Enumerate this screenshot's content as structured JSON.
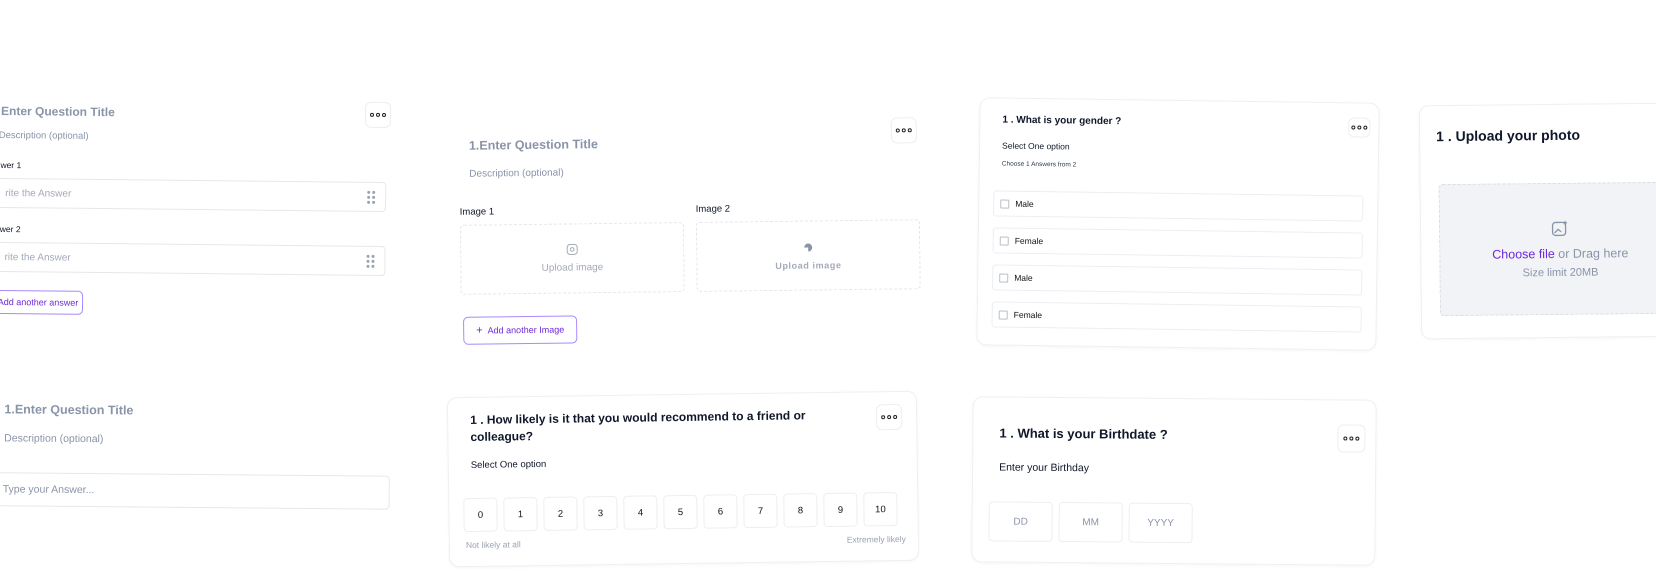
{
  "card_text_question": {
    "title": "Enter Question Title",
    "description": "Description (optional)",
    "answer1_label": "wer 1",
    "answer1_placeholder": "rite the Answer",
    "answer2_label": "wer 2",
    "answer2_placeholder": "rite the Answer",
    "add_button": "Add another answer"
  },
  "card_image_question": {
    "title": "1.Enter Question Title",
    "description": "Description (optional)",
    "image1_label": "Image 1",
    "image1_upload": "Upload image",
    "image2_label": "Image 2",
    "image2_upload": "Upload image",
    "add_button": "Add another Image"
  },
  "card_gender": {
    "title": "1 . What is your gender ?",
    "subtitle": "Select One option",
    "hint": "Choose 1 Answers from 2",
    "options": [
      "Male",
      "Female",
      "Male",
      "Female"
    ]
  },
  "card_upload_photo": {
    "title": "1 . Upload your photo",
    "choose_link": "Choose file",
    "drag_text": " or Drag here",
    "limit": "Size limit 20MB"
  },
  "card_short_answer": {
    "title": "1.Enter Question Title",
    "description": "Description (optional)",
    "placeholder": "Type your Answer..."
  },
  "card_nps": {
    "title": "1 . How likely is it that you would recommend to a friend or colleague?",
    "subtitle": "Select One option",
    "scale": [
      "0",
      "1",
      "2",
      "3",
      "4",
      "5",
      "6",
      "7",
      "8",
      "9",
      "10"
    ],
    "low_label": "Not likely at all",
    "high_label": "Extremely likely"
  },
  "card_birthdate": {
    "title": "1 . What is your Birthdate ?",
    "subtitle": "Enter your Birthday",
    "day": "DD",
    "month": "MM",
    "year": "YYYY"
  },
  "colors": {
    "accent": "#6d28d9",
    "placeholder": "#8a94a8",
    "border": "#eceef2"
  },
  "icons": [
    "more-dots-icon",
    "drag-handle-icon",
    "image-upload-icon",
    "plus-icon",
    "checkbox-icon"
  ]
}
